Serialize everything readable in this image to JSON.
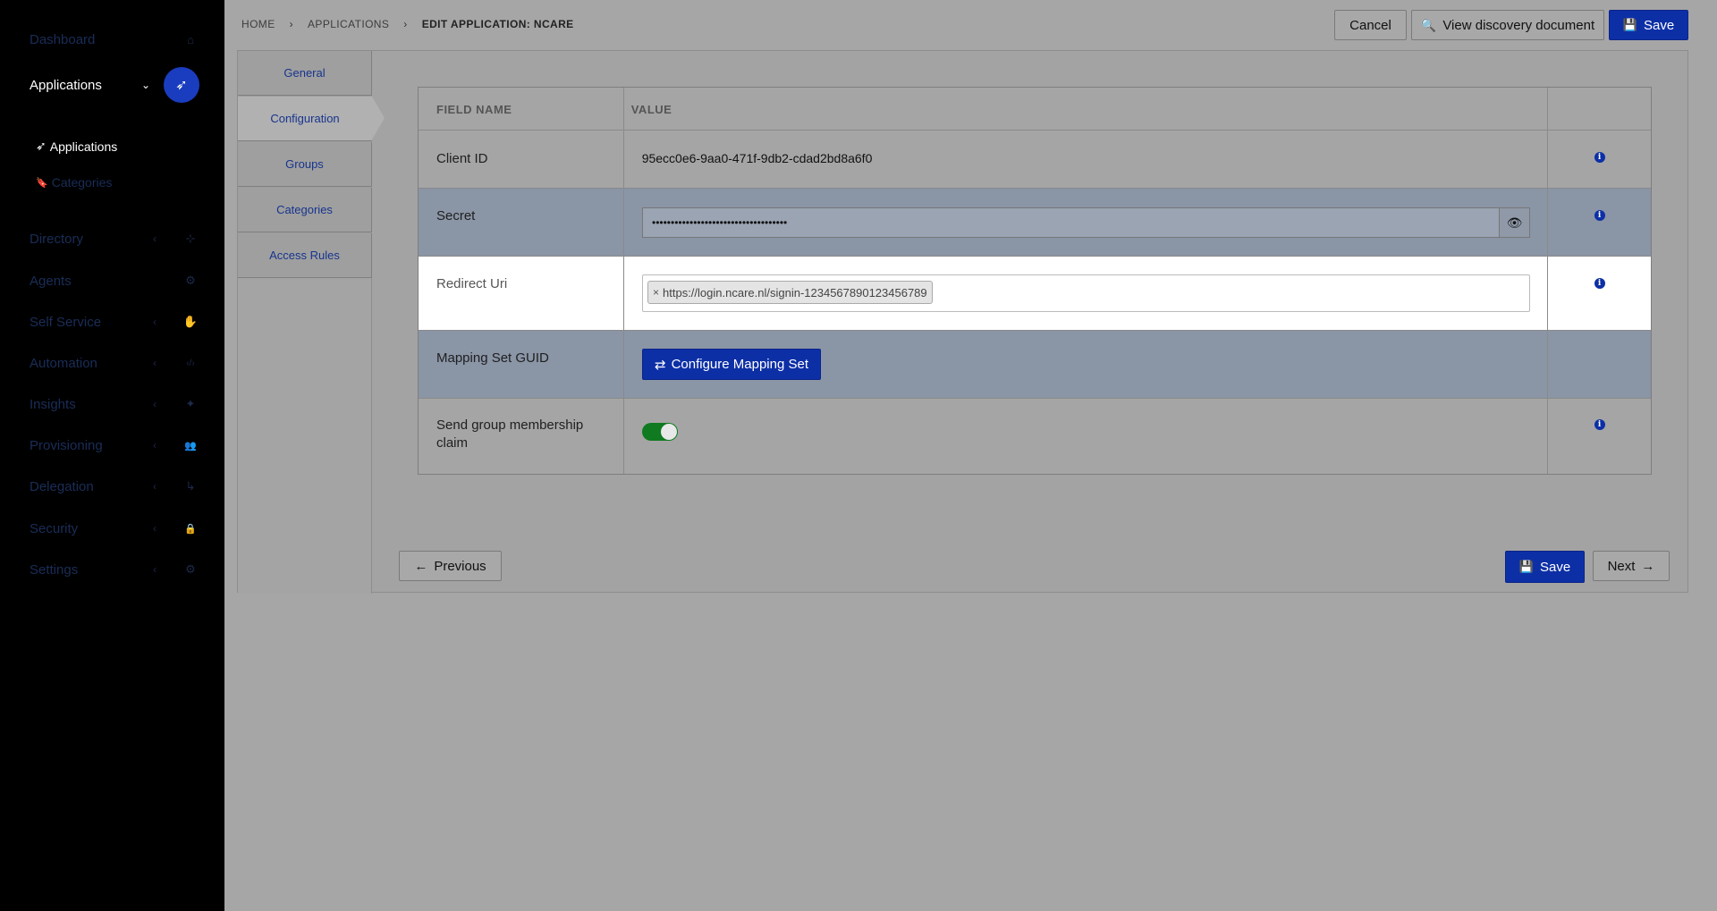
{
  "sidebar": {
    "items": [
      {
        "label": "Dashboard",
        "icon": "home-icon",
        "glyph": "⌂"
      },
      {
        "label": "Applications",
        "icon": "rocket-icon",
        "glyph": "➶"
      },
      {
        "label": "Directory",
        "icon": "sitemap-icon",
        "glyph": "⊹"
      },
      {
        "label": "Agents",
        "icon": "cogs-icon",
        "glyph": "⚙"
      },
      {
        "label": "Self Service",
        "icon": "hand-icon",
        "glyph": "✋"
      },
      {
        "label": "Automation",
        "icon": "code-icon",
        "glyph": "‹/›"
      },
      {
        "label": "Insights",
        "icon": "lightbulb-icon",
        "glyph": "✦"
      },
      {
        "label": "Provisioning",
        "icon": "users-icon",
        "glyph": "👥"
      },
      {
        "label": "Delegation",
        "icon": "level-down-icon",
        "glyph": "↳"
      },
      {
        "label": "Security",
        "icon": "lock-icon",
        "glyph": "🔒"
      },
      {
        "label": "Settings",
        "icon": "gear-icon",
        "glyph": "⚙"
      }
    ],
    "sub_items": [
      {
        "label": "Applications",
        "glyph": "➶"
      },
      {
        "label": "Categories",
        "glyph": "🔖"
      }
    ]
  },
  "breadcrumb": {
    "home": "HOME",
    "applications": "APPLICATIONS",
    "current": "EDIT APPLICATION: NCARE",
    "sep": "›"
  },
  "toolbar": {
    "cancel": "Cancel",
    "discovery": "View discovery document",
    "save": "Save"
  },
  "tabs": [
    "General",
    "Configuration",
    "Groups",
    "Categories",
    "Access Rules"
  ],
  "table": {
    "header_name": "FIELD NAME",
    "header_value": "VALUE",
    "client_id_label": "Client ID",
    "client_id_value": "95ecc0e6-9aa0-471f-9db2-cdad2bd8a6f0",
    "secret_label": "Secret",
    "secret_value": "••••••••••••••••••••••••••••••••••••",
    "redirect_label": "Redirect Uri",
    "redirect_value": "https://login.ncare.nl/signin-1234567890123456789",
    "mapping_label": "Mapping Set GUID",
    "mapping_button": "Configure Mapping Set",
    "group_claim_label_1": "Send group membership",
    "group_claim_label_2": "claim",
    "group_claim_enabled": true
  },
  "footer": {
    "previous": "Previous",
    "save": "Save",
    "next": "Next"
  },
  "colors": {
    "primary": "#0d2fa6",
    "toggle_on": "#0f7a1f"
  }
}
